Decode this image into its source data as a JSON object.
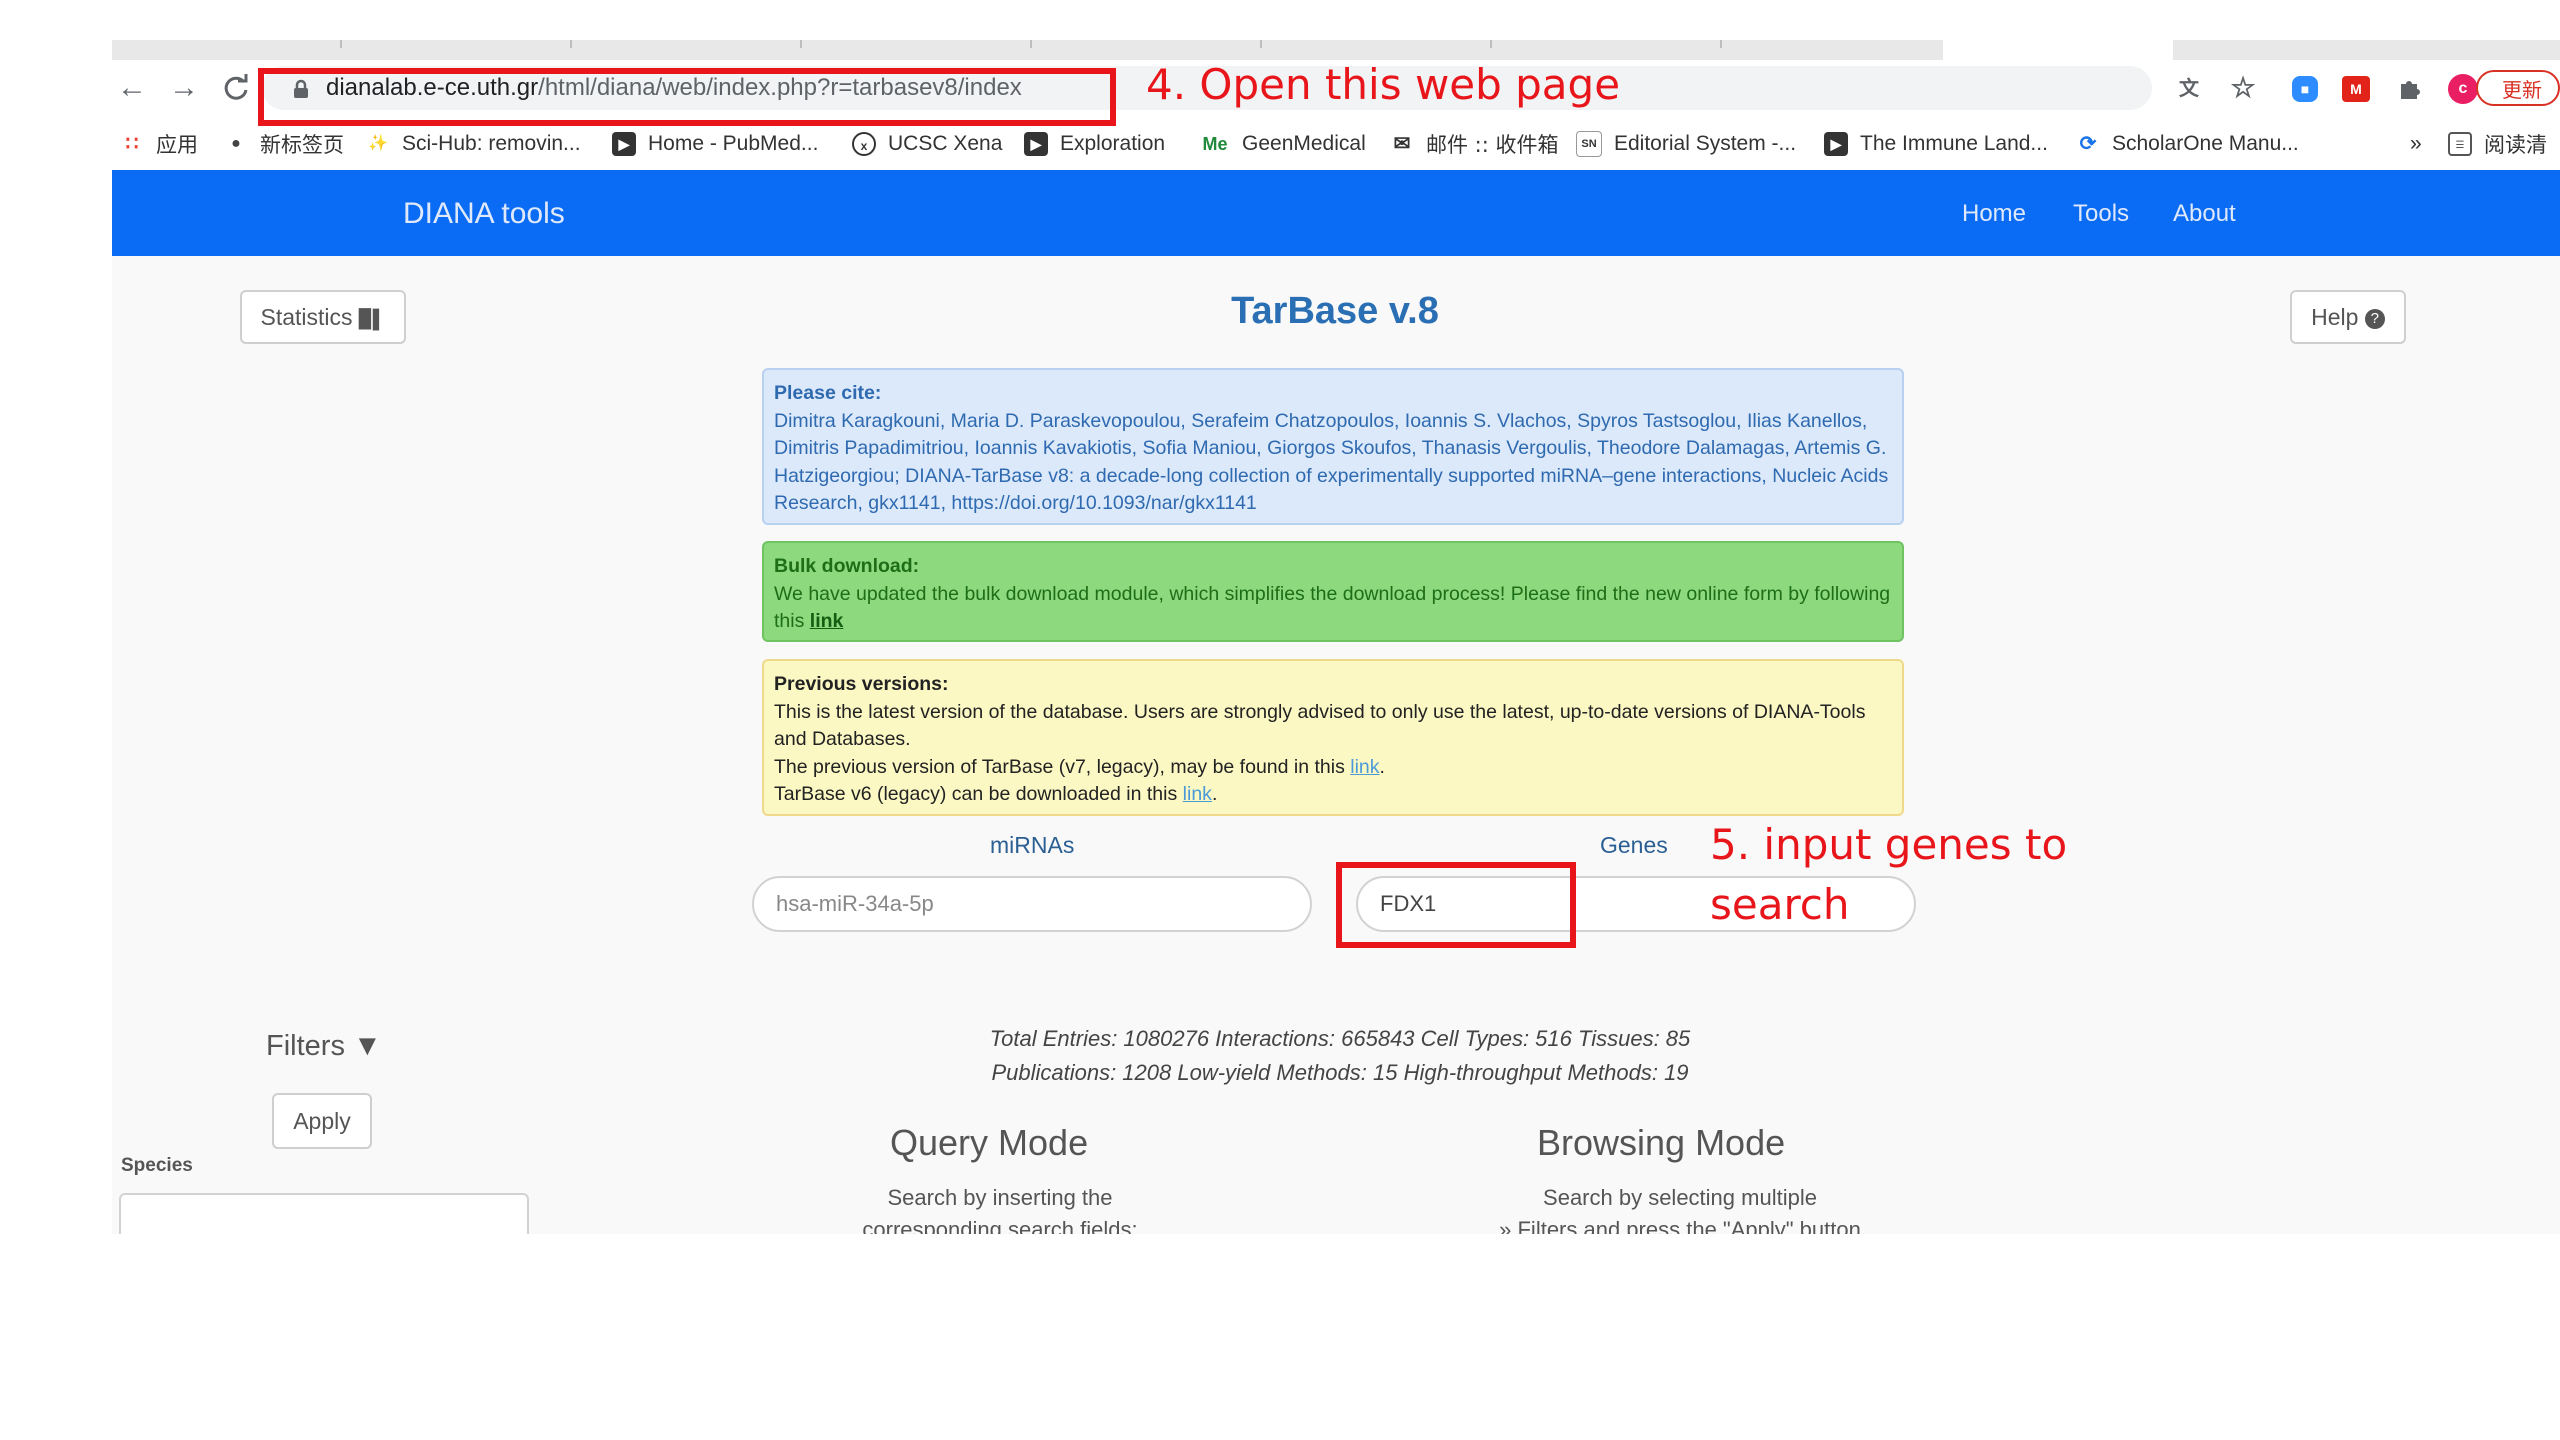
{
  "browser": {
    "url_host": "dianalab.e-ce.uth.gr",
    "url_path": "/html/diana/web/index.php?r=tarbasev8/index",
    "update_label": "更新",
    "bookmarks": [
      {
        "label": "应用",
        "icon": "apps-grid-icon"
      },
      {
        "label": "新标签页",
        "icon": "globe-icon"
      },
      {
        "label": "Sci-Hub: removin...",
        "icon": "scihub-icon"
      },
      {
        "label": "Home - PubMed...",
        "icon": "pubmed-icon"
      },
      {
        "label": "UCSC Xena",
        "icon": "xena-icon"
      },
      {
        "label": "Exploration",
        "icon": "pubmed-icon"
      },
      {
        "label": "GeenMedical",
        "icon": "geenmedical-icon"
      },
      {
        "label": "邮件 :: 收件箱",
        "icon": "mail-icon"
      },
      {
        "label": "Editorial System -...",
        "icon": "sn-icon"
      },
      {
        "label": "The Immune Land...",
        "icon": "pubmed-icon"
      },
      {
        "label": "ScholarOne Manu...",
        "icon": "scholarone-icon"
      }
    ],
    "bookmarks_overflow": "»",
    "reading_list": "阅读清"
  },
  "site": {
    "brand": "DIANA tools",
    "nav": [
      "Home",
      "Tools",
      "About"
    ],
    "statistics_label": "Statistics",
    "help_label": "Help",
    "title": "TarBase v.8",
    "cite": {
      "heading": "Please cite:",
      "text": "Dimitra Karagkouni, Maria D. Paraskevopoulou, Serafeim Chatzopoulos, Ioannis S. Vlachos, Spyros Tastsoglou, Ilias Kanellos, Dimitris Papadimitriou, Ioannis Kavakiotis, Sofia Maniou, Giorgos Skoufos, Thanasis Vergoulis, Theodore Dalamagas, Artemis G. Hatzigeorgiou; DIANA-TarBase v8: a decade-long collection of experimentally supported miRNA–gene interactions, Nucleic Acids Research, gkx1141, https://doi.org/10.1093/nar/gkx1141"
    },
    "bulk": {
      "heading": "Bulk download:",
      "text": "We have updated the bulk download module, which simplifies the download process! Please find the new online form by following this",
      "link": "link"
    },
    "previous": {
      "heading": "Previous versions:",
      "line1": "This is the latest version of the database. Users are strongly advised to only use the latest, up-to-date versions of DIANA-Tools and Databases.",
      "line2_pre": "The previous version of TarBase (v7, legacy), may be found in this",
      "line2_link": "link",
      "line2_post": ".",
      "line3_pre": "TarBase v6 (legacy) can be downloaded in this",
      "line3_link": "link",
      "line3_post": "."
    },
    "mirnas_label": "miRNAs",
    "mirnas_placeholder": "hsa-miR-34a-5p",
    "genes_label": "Genes",
    "genes_value": "FDX1",
    "stats_line1": "Total Entries: 1080276 Interactions: 665843 Cell Types: 516 Tissues: 85",
    "stats_line2": "Publications: 1208 Low-yield Methods: 15 High-throughput Methods: 19",
    "filters_label": "Filters",
    "apply_label": "Apply",
    "species_label": "Species",
    "query_mode": {
      "title": "Query Mode",
      "line1": "Search by inserting the",
      "line2": "corresponding search fields:"
    },
    "browsing_mode": {
      "title": "Browsing Mode",
      "line1": "Search by selecting multiple",
      "line2": "» Filters and press the \"Apply\" button"
    }
  },
  "annotations": {
    "step4": "4. Open this web page",
    "step5_line1": "5. input genes to",
    "step5_line2": "search"
  },
  "colors": {
    "navbar": "#0a6cf5",
    "annotation": "#e8161b",
    "title": "#2a6fb3"
  }
}
